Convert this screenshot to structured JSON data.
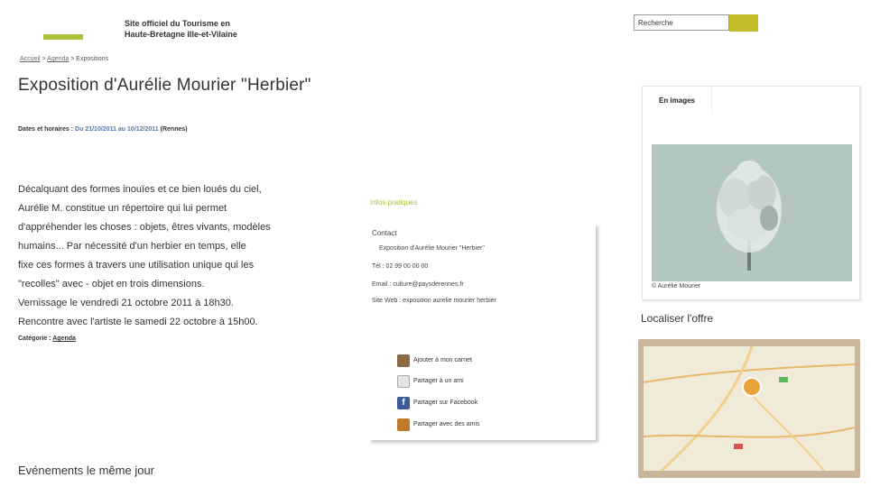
{
  "header": {
    "logo_line1": "Site officiel du Tourisme en",
    "logo_line2": "Haute-Bretagne Ille-et-Vilaine"
  },
  "search": {
    "placeholder": "Recherche",
    "value": "Recherche"
  },
  "breadcrumb": {
    "home": "Accueil",
    "sep1": " > ",
    "section": "Agenda",
    "sep2": " > ",
    "current": "Expositions"
  },
  "main": {
    "title": "Exposition d'Aurélie Mourier \"Herbier\"",
    "dates_label": "Dates et horaires :",
    "dates_value": "Du 21/10/2011 au 10/12/2011",
    "dates_extra": "(Rennes)",
    "description": [
      "Décalquant des formes inouïes et ce bien loués du ciel,",
      "Aurélie M. constitue un répertoire qui lui permet",
      "d'appréhender les choses : objets, êtres vivants, modèles",
      "humains... Par nécessité d'un herbier en temps, elle",
      "fixe ces formes à travers une utilisation unique qui les",
      "\"recolles\" avec - objet en trois dimensions.",
      "Vernissage le vendredi 21 octobre 2011 à 18h30.",
      "Rencontre avec l'artiste le samedi 22 octobre à 15h00."
    ],
    "category_label": "Catégorie :",
    "category_value": "Agenda",
    "same_day": "Evénements le même jour"
  },
  "info": {
    "title": "Infos pratiques",
    "contact_label": "Contact",
    "contact_name": "Exposition d'Aurélie Mourier \"Herbier\"",
    "tel": "Tél : 02 99 00 00 00",
    "email": "Email : culture@paysderennes.fr",
    "website": "Site Web : exposition aurelie mourier herbier"
  },
  "share": [
    {
      "label": "Ajouter à mon carnet",
      "icon": "notebook-icon",
      "color": "#8c6a44"
    },
    {
      "label": "Partager à un ami",
      "icon": "email-icon",
      "color": "#d9d9d9"
    },
    {
      "label": "Partager sur Facebook",
      "icon": "facebook-icon",
      "color": "#3b5998"
    },
    {
      "label": "Partager avec des amis",
      "icon": "friends-icon",
      "color": "#c0782b"
    }
  ],
  "sidebar": {
    "images_tab": "En images",
    "photo_caption": "© Aurélie Mourier",
    "localize_title": "Localiser l'offre"
  },
  "colors": {
    "accent_green": "#a8c23a",
    "search_button": "#c4bb2a"
  }
}
